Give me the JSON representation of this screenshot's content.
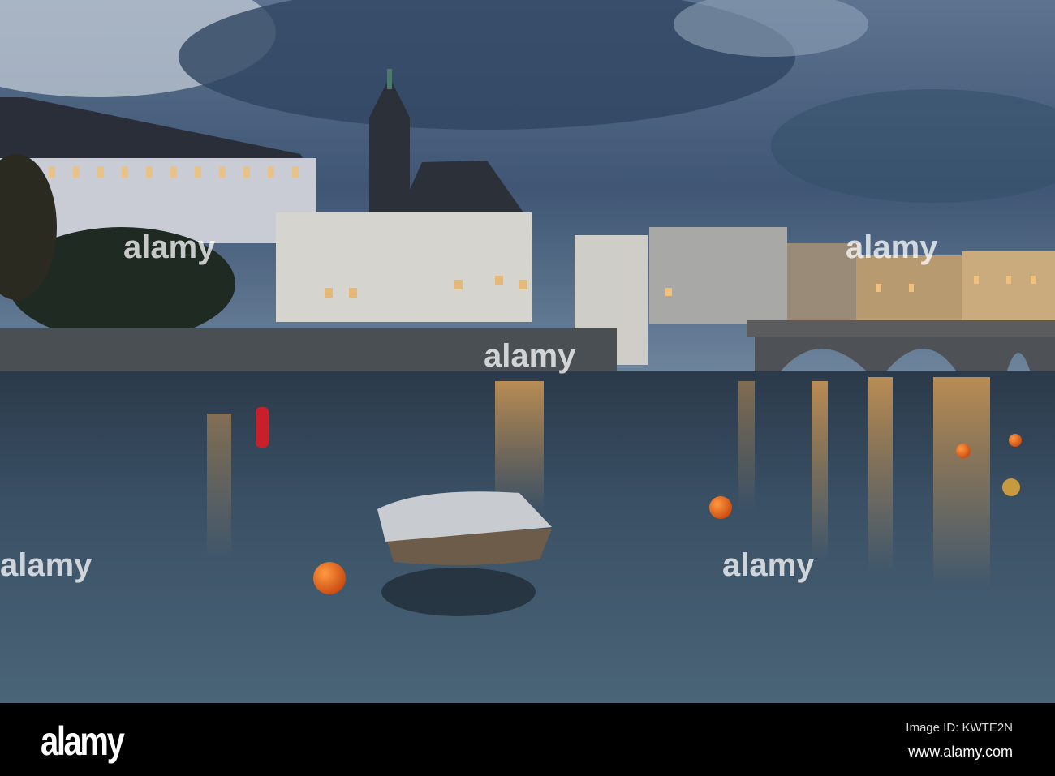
{
  "photo": {
    "subject": "Riverside old town at dusk with church tower, bridge, covered boat and buoys",
    "colors": {
      "sky": "#3d5470",
      "water": "#34475a",
      "lights": "#f0b060",
      "buoy": "#e2641c"
    }
  },
  "watermark": {
    "text": "alamy"
  },
  "footer": {
    "logo": "alamy",
    "image_id": "Image ID: KWTE2N",
    "url": "www.alamy.com"
  }
}
